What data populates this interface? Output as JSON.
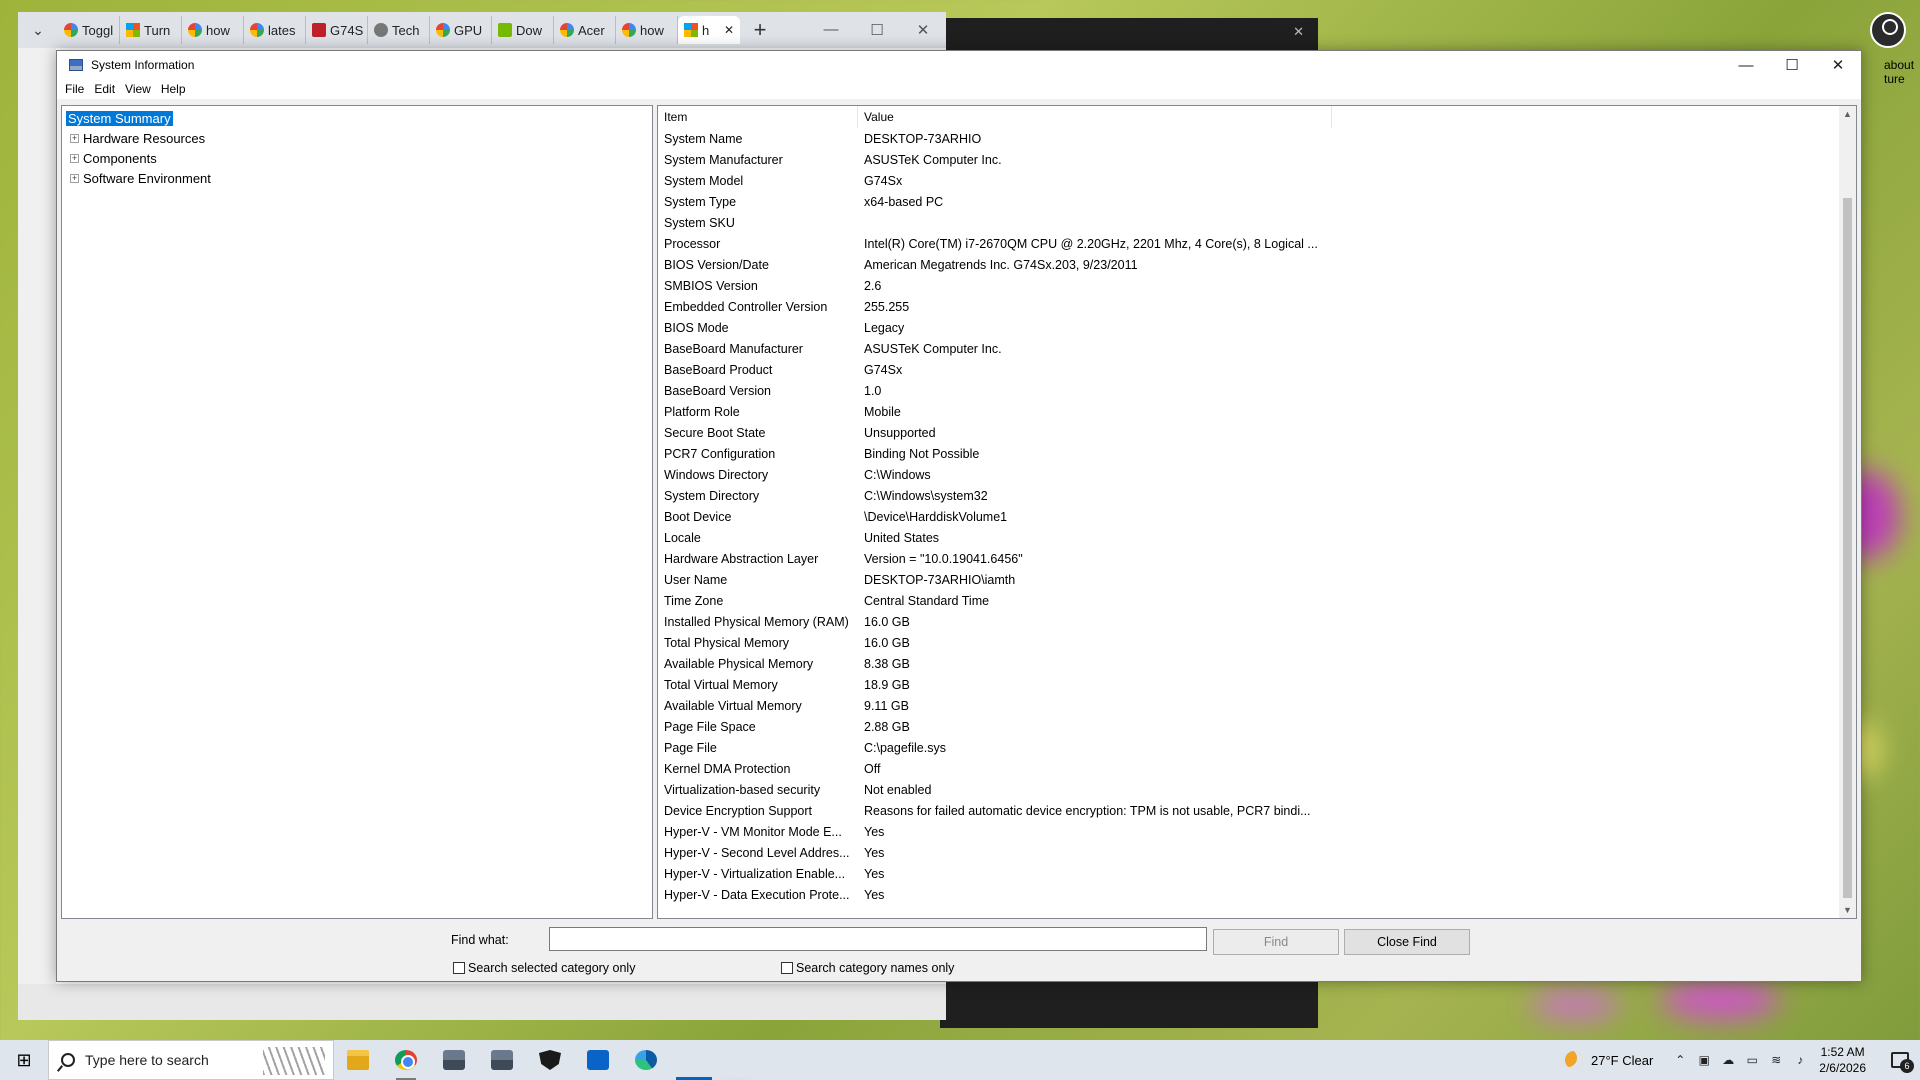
{
  "browser": {
    "tabs": [
      {
        "label": "Toggl",
        "icon": "google"
      },
      {
        "label": "Turn",
        "icon": "microsoft"
      },
      {
        "label": "how",
        "icon": "google"
      },
      {
        "label": "lates",
        "icon": "google"
      },
      {
        "label": "G74S",
        "icon": "rog"
      },
      {
        "label": "Tech",
        "icon": "tech"
      },
      {
        "label": "GPU",
        "icon": "google"
      },
      {
        "label": "Dow",
        "icon": "nvidia"
      },
      {
        "label": "Acer",
        "icon": "google"
      },
      {
        "label": "how",
        "icon": "google"
      },
      {
        "label": "h",
        "icon": "microsoft",
        "active": true
      }
    ]
  },
  "desktop": {
    "about_text": "about ture"
  },
  "window": {
    "title": "System Information",
    "menus": [
      "File",
      "Edit",
      "View",
      "Help"
    ],
    "tree": [
      {
        "label": "System Summary",
        "selected": true
      },
      {
        "label": "Hardware Resources",
        "expandable": true
      },
      {
        "label": "Components",
        "expandable": true
      },
      {
        "label": "Software Environment",
        "expandable": true
      }
    ],
    "columns": {
      "item": "Item",
      "value": "Value"
    },
    "rows": [
      [
        "System Name",
        "DESKTOP-73ARHIO"
      ],
      [
        "System Manufacturer",
        "ASUSTeK Computer Inc."
      ],
      [
        "System Model",
        "G74Sx"
      ],
      [
        "System Type",
        "x64-based PC"
      ],
      [
        "System SKU",
        ""
      ],
      [
        "Processor",
        "Intel(R) Core(TM) i7-2670QM CPU @ 2.20GHz, 2201 Mhz, 4 Core(s), 8 Logical ..."
      ],
      [
        "BIOS Version/Date",
        "American Megatrends Inc. G74Sx.203, 9/23/2011"
      ],
      [
        "SMBIOS Version",
        "2.6"
      ],
      [
        "Embedded Controller Version",
        "255.255"
      ],
      [
        "BIOS Mode",
        "Legacy"
      ],
      [
        "BaseBoard Manufacturer",
        "ASUSTeK Computer Inc."
      ],
      [
        "BaseBoard Product",
        "G74Sx"
      ],
      [
        "BaseBoard Version",
        "1.0"
      ],
      [
        "Platform Role",
        "Mobile"
      ],
      [
        "Secure Boot State",
        "Unsupported"
      ],
      [
        "PCR7 Configuration",
        "Binding Not Possible"
      ],
      [
        "Windows Directory",
        "C:\\Windows"
      ],
      [
        "System Directory",
        "C:\\Windows\\system32"
      ],
      [
        "Boot Device",
        "\\Device\\HarddiskVolume1"
      ],
      [
        "Locale",
        "United States"
      ],
      [
        "Hardware Abstraction Layer",
        "Version = \"10.0.19041.6456\""
      ],
      [
        "User Name",
        "DESKTOP-73ARHIO\\iamth"
      ],
      [
        "Time Zone",
        "Central Standard Time"
      ],
      [
        "Installed Physical Memory (RAM)",
        "16.0 GB"
      ],
      [
        "Total Physical Memory",
        "16.0 GB"
      ],
      [
        "Available Physical Memory",
        "8.38 GB"
      ],
      [
        "Total Virtual Memory",
        "18.9 GB"
      ],
      [
        "Available Virtual Memory",
        "9.11 GB"
      ],
      [
        "Page File Space",
        "2.88 GB"
      ],
      [
        "Page File",
        "C:\\pagefile.sys"
      ],
      [
        "Kernel DMA Protection",
        "Off"
      ],
      [
        "Virtualization-based security",
        "Not enabled"
      ],
      [
        "Device Encryption Support",
        "Reasons for failed automatic device encryption: TPM is not usable, PCR7 bindi..."
      ],
      [
        "Hyper-V - VM Monitor Mode E...",
        "Yes"
      ],
      [
        "Hyper-V - Second Level Addres...",
        "Yes"
      ],
      [
        "Hyper-V - Virtualization Enable...",
        "Yes"
      ],
      [
        "Hyper-V - Data Execution Prote...",
        "Yes"
      ]
    ],
    "find": {
      "label": "Find what:",
      "value": "",
      "find_button": "Find",
      "close_button": "Close Find",
      "opt_selected_category": "Search selected category only",
      "opt_category_names": "Search category names only"
    }
  },
  "taskbar": {
    "search_placeholder": "Type here to search",
    "weather": "27°F  Clear",
    "time": "1:52 AM",
    "date": "2/6/2026",
    "notification_count": "6"
  },
  "colors": {
    "selection": "#0078d7",
    "taskbar_accent": "#0067c0"
  }
}
